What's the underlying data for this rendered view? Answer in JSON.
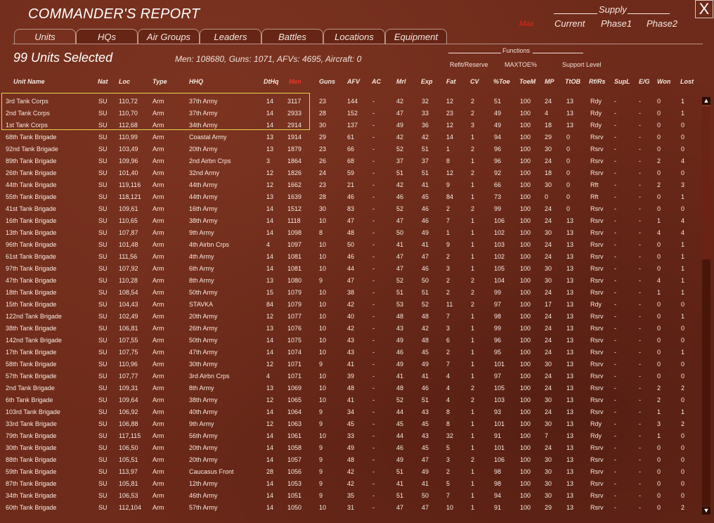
{
  "window": {
    "title": "COMMANDER'S REPORT",
    "close_label": "X"
  },
  "supply": {
    "header": "Supply",
    "tabs": [
      "Max",
      "Current",
      "Phase1",
      "Phase2"
    ],
    "active_tab": "Max",
    "active_color": "#e02a1a"
  },
  "tabs": [
    {
      "label": "Units",
      "active": true
    },
    {
      "label": "HQs"
    },
    {
      "label": "Air Groups"
    },
    {
      "label": "Leaders"
    },
    {
      "label": "Battles"
    },
    {
      "label": "Locations"
    },
    {
      "label": "Equipment"
    }
  ],
  "summary": {
    "count_text": "99 Units Selected",
    "totals_text": "Men: 108680, Guns: 1071, AFVs: 4695, Aircraft: 0"
  },
  "functions": {
    "header": "Functions",
    "items": [
      "Refit/Reserve",
      "MAXTOE%",
      "Support Level"
    ]
  },
  "columns": [
    "Unit Name",
    "Nat",
    "Loc",
    "Type",
    "HHQ",
    "DtHq",
    "Men",
    "Guns",
    "AFV",
    "AC",
    "Mrl",
    "Exp",
    "Fat",
    "CV",
    "%Toe",
    "ToeM",
    "MP",
    "TtOB",
    "Rf/Rs",
    "SupL",
    "E/G",
    "Won",
    "Lost"
  ],
  "sorted_column": "Men",
  "selected_rows": 3,
  "rows": [
    [
      "3rd Tank Corps",
      "SU",
      "110,72",
      "Arm",
      "37th Army",
      "14",
      "3117",
      "23",
      "144",
      "-",
      "42",
      "32",
      "12",
      "2",
      "51",
      "100",
      "24",
      "13",
      "Rdy",
      "-",
      "-",
      "0",
      "1"
    ],
    [
      "2nd Tank Corps",
      "SU",
      "110,70",
      "Arm",
      "37th Army",
      "14",
      "2933",
      "28",
      "152",
      "-",
      "47",
      "33",
      "23",
      "2",
      "49",
      "100",
      "4",
      "13",
      "Rdy",
      "-",
      "-",
      "0",
      "1"
    ],
    [
      "1st Tank Corps",
      "SU",
      "112,68",
      "Arm",
      "34th Army",
      "14",
      "2914",
      "30",
      "137",
      "-",
      "49",
      "36",
      "12",
      "3",
      "49",
      "100",
      "18",
      "13",
      "Rdy",
      "-",
      "-",
      "0",
      "0"
    ],
    [
      "68th Tank Brigade",
      "SU",
      "110,99",
      "Arm",
      "Coastal Army",
      "13",
      "1914",
      "29",
      "61",
      "-",
      "42",
      "42",
      "14",
      "1",
      "94",
      "100",
      "29",
      "0",
      "Rsrv",
      "-",
      "-",
      "0",
      "0"
    ],
    [
      "92nd Tank Brigade",
      "SU",
      "103,49",
      "Arm",
      "20th Army",
      "13",
      "1879",
      "23",
      "66",
      "-",
      "52",
      "51",
      "1",
      "2",
      "96",
      "100",
      "30",
      "0",
      "Rsrv",
      "-",
      "-",
      "0",
      "0"
    ],
    [
      "89th Tank Brigade",
      "SU",
      "109,96",
      "Arm",
      "2nd Airbn Crps",
      "3",
      "1864",
      "26",
      "68",
      "-",
      "37",
      "37",
      "8",
      "1",
      "96",
      "100",
      "24",
      "0",
      "Rsrv",
      "-",
      "-",
      "2",
      "4"
    ],
    [
      "26th Tank Brigade",
      "SU",
      "101,40",
      "Arm",
      "32nd Army",
      "12",
      "1826",
      "24",
      "59",
      "-",
      "51",
      "51",
      "12",
      "2",
      "92",
      "100",
      "18",
      "0",
      "Rsrv",
      "-",
      "-",
      "0",
      "0"
    ],
    [
      "44th Tank Brigade",
      "SU",
      "119,116",
      "Arm",
      "44th Army",
      "12",
      "1662",
      "23",
      "21",
      "-",
      "42",
      "41",
      "9",
      "1",
      "66",
      "100",
      "30",
      "0",
      "Rft",
      "-",
      "-",
      "2",
      "3"
    ],
    [
      "55th Tank Brigade",
      "SU",
      "118,121",
      "Arm",
      "44th Army",
      "13",
      "1639",
      "28",
      "46",
      "-",
      "46",
      "45",
      "84",
      "1",
      "73",
      "100",
      "0",
      "0",
      "Rft",
      "-",
      "-",
      "0",
      "1"
    ],
    [
      "41st Tank Brigade",
      "SU",
      "109,61",
      "Arm",
      "16th Army",
      "14",
      "1512",
      "30",
      "83",
      "-",
      "52",
      "46",
      "2",
      "2",
      "99",
      "100",
      "24",
      "0",
      "Rsrv",
      "-",
      "-",
      "0",
      "0"
    ],
    [
      "16th Tank Brigade",
      "SU",
      "110,65",
      "Arm",
      "38th Army",
      "14",
      "1118",
      "10",
      "47",
      "-",
      "47",
      "46",
      "7",
      "1",
      "106",
      "100",
      "24",
      "13",
      "Rsrv",
      "-",
      "-",
      "1",
      "4"
    ],
    [
      "13th Tank Brigade",
      "SU",
      "107,87",
      "Arm",
      "9th Army",
      "14",
      "1098",
      "8",
      "48",
      "-",
      "50",
      "49",
      "1",
      "1",
      "102",
      "100",
      "30",
      "13",
      "Rsrv",
      "-",
      "-",
      "4",
      "4"
    ],
    [
      "96th Tank Brigade",
      "SU",
      "101,48",
      "Arm",
      "4th Airbn Crps",
      "4",
      "1097",
      "10",
      "50",
      "-",
      "41",
      "41",
      "9",
      "1",
      "103",
      "100",
      "24",
      "13",
      "Rsrv",
      "-",
      "-",
      "0",
      "1"
    ],
    [
      "61st Tank Brigade",
      "SU",
      "111,56",
      "Arm",
      "4th Army",
      "14",
      "1081",
      "10",
      "46",
      "-",
      "47",
      "47",
      "2",
      "1",
      "102",
      "100",
      "24",
      "13",
      "Rsrv",
      "-",
      "-",
      "0",
      "1"
    ],
    [
      "97th Tank Brigade",
      "SU",
      "107,92",
      "Arm",
      "6th Army",
      "14",
      "1081",
      "10",
      "44",
      "-",
      "47",
      "46",
      "3",
      "1",
      "105",
      "100",
      "30",
      "13",
      "Rsrv",
      "-",
      "-",
      "0",
      "1"
    ],
    [
      "47th Tank Brigade",
      "SU",
      "110,28",
      "Arm",
      "8th Army",
      "13",
      "1080",
      "9",
      "47",
      "-",
      "52",
      "50",
      "2",
      "2",
      "104",
      "100",
      "30",
      "13",
      "Rsrv",
      "-",
      "-",
      "4",
      "1"
    ],
    [
      "18th Tank Brigade",
      "SU",
      "108,54",
      "Arm",
      "50th Army",
      "15",
      "1079",
      "10",
      "38",
      "-",
      "51",
      "51",
      "2",
      "2",
      "99",
      "100",
      "24",
      "13",
      "Rsrv",
      "-",
      "-",
      "1",
      "1"
    ],
    [
      "15th Tank Brigade",
      "SU",
      "104,43",
      "Arm",
      "STAVKA",
      "84",
      "1079",
      "10",
      "42",
      "-",
      "53",
      "52",
      "11",
      "2",
      "97",
      "100",
      "17",
      "13",
      "Rdy",
      "-",
      "-",
      "0",
      "0"
    ],
    [
      "122nd Tank Brigade",
      "SU",
      "102,49",
      "Arm",
      "20th Army",
      "12",
      "1077",
      "10",
      "40",
      "-",
      "48",
      "48",
      "7",
      "1",
      "98",
      "100",
      "24",
      "13",
      "Rsrv",
      "-",
      "-",
      "0",
      "1"
    ],
    [
      "38th Tank Brigade",
      "SU",
      "106,81",
      "Arm",
      "26th Army",
      "13",
      "1076",
      "10",
      "42",
      "-",
      "43",
      "42",
      "3",
      "1",
      "99",
      "100",
      "24",
      "13",
      "Rsrv",
      "-",
      "-",
      "0",
      "0"
    ],
    [
      "142nd Tank Brigade",
      "SU",
      "107,55",
      "Arm",
      "50th Army",
      "14",
      "1075",
      "10",
      "43",
      "-",
      "49",
      "48",
      "6",
      "1",
      "96",
      "100",
      "24",
      "13",
      "Rsrv",
      "-",
      "-",
      "0",
      "0"
    ],
    [
      "17th Tank Brigade",
      "SU",
      "107,75",
      "Arm",
      "47th Army",
      "14",
      "1074",
      "10",
      "43",
      "-",
      "46",
      "45",
      "2",
      "1",
      "95",
      "100",
      "24",
      "13",
      "Rsrv",
      "-",
      "-",
      "0",
      "1"
    ],
    [
      "58th Tank Brigade",
      "SU",
      "110,96",
      "Arm",
      "30th Army",
      "12",
      "1071",
      "9",
      "41",
      "-",
      "49",
      "49",
      "7",
      "1",
      "101",
      "100",
      "30",
      "13",
      "Rsrv",
      "-",
      "-",
      "0",
      "0"
    ],
    [
      "57th Tank Brigade",
      "SU",
      "107,77",
      "Arm",
      "3rd Airbn Crps",
      "4",
      "1071",
      "10",
      "39",
      "-",
      "41",
      "41",
      "4",
      "1",
      "97",
      "100",
      "24",
      "13",
      "Rsrv",
      "-",
      "-",
      "0",
      "0"
    ],
    [
      "2nd Tank Brigade",
      "SU",
      "109,31",
      "Arm",
      "8th Army",
      "13",
      "1069",
      "10",
      "48",
      "-",
      "48",
      "46",
      "4",
      "2",
      "105",
      "100",
      "24",
      "13",
      "Rsrv",
      "-",
      "-",
      "2",
      "2"
    ],
    [
      "6th Tank Brigade",
      "SU",
      "109,64",
      "Arm",
      "38th Army",
      "12",
      "1065",
      "10",
      "41",
      "-",
      "52",
      "51",
      "4",
      "2",
      "103",
      "100",
      "30",
      "13",
      "Rsrv",
      "-",
      "-",
      "2",
      "0"
    ],
    [
      "103rd Tank Brigade",
      "SU",
      "106,92",
      "Arm",
      "40th Army",
      "14",
      "1064",
      "9",
      "34",
      "-",
      "44",
      "43",
      "8",
      "1",
      "93",
      "100",
      "24",
      "13",
      "Rsrv",
      "-",
      "-",
      "1",
      "1"
    ],
    [
      "33rd Tank Brigade",
      "SU",
      "106,88",
      "Arm",
      "9th Army",
      "12",
      "1063",
      "9",
      "45",
      "-",
      "45",
      "45",
      "8",
      "1",
      "101",
      "100",
      "30",
      "13",
      "Rdy",
      "-",
      "-",
      "3",
      "2"
    ],
    [
      "79th Tank Brigade",
      "SU",
      "117,115",
      "Arm",
      "56th Army",
      "14",
      "1061",
      "10",
      "33",
      "-",
      "44",
      "43",
      "32",
      "1",
      "91",
      "100",
      "7",
      "13",
      "Rdy",
      "-",
      "-",
      "1",
      "0"
    ],
    [
      "30th Tank Brigade",
      "SU",
      "106,50",
      "Arm",
      "20th Army",
      "14",
      "1058",
      "9",
      "49",
      "-",
      "46",
      "45",
      "5",
      "1",
      "101",
      "100",
      "24",
      "13",
      "Rsrv",
      "-",
      "-",
      "0",
      "0"
    ],
    [
      "88th Tank Brigade",
      "SU",
      "105,51",
      "Arm",
      "20th Army",
      "14",
      "1057",
      "9",
      "48",
      "-",
      "49",
      "47",
      "3",
      "2",
      "106",
      "100",
      "30",
      "13",
      "Rsrv",
      "-",
      "-",
      "0",
      "0"
    ],
    [
      "59th Tank Brigade",
      "SU",
      "113,97",
      "Arm",
      "Caucasus Front",
      "28",
      "1056",
      "9",
      "42",
      "-",
      "51",
      "49",
      "2",
      "1",
      "98",
      "100",
      "30",
      "13",
      "Rsrv",
      "-",
      "-",
      "0",
      "0"
    ],
    [
      "87th Tank Brigade",
      "SU",
      "105,81",
      "Arm",
      "12th Army",
      "14",
      "1053",
      "9",
      "42",
      "-",
      "41",
      "41",
      "5",
      "1",
      "98",
      "100",
      "30",
      "13",
      "Rsrv",
      "-",
      "-",
      "0",
      "0"
    ],
    [
      "34th Tank Brigade",
      "SU",
      "106,53",
      "Arm",
      "46th Army",
      "14",
      "1051",
      "9",
      "35",
      "-",
      "51",
      "50",
      "7",
      "1",
      "94",
      "100",
      "30",
      "13",
      "Rsrv",
      "-",
      "-",
      "0",
      "0"
    ],
    [
      "60th Tank Brigade",
      "SU",
      "112,104",
      "Arm",
      "57th Army",
      "14",
      "1050",
      "10",
      "31",
      "-",
      "47",
      "47",
      "10",
      "1",
      "91",
      "100",
      "29",
      "13",
      "Rsrv",
      "-",
      "-",
      "0",
      "2"
    ]
  ]
}
